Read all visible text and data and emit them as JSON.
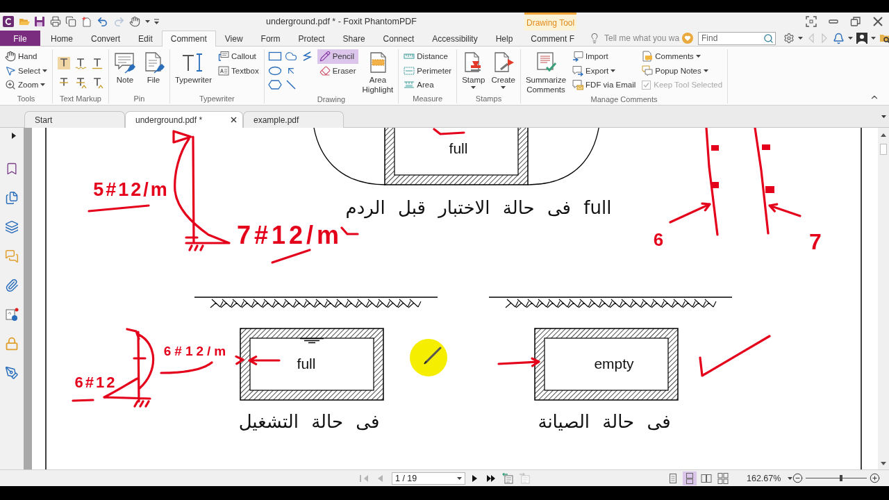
{
  "window": {
    "title": "underground.pdf * - Foxit PhantomPDF",
    "context_tab": "Drawing Tool"
  },
  "ribbon_tabs": [
    {
      "label": "File",
      "kind": "file",
      "selected": false
    },
    {
      "label": "Home",
      "kind": "tab",
      "selected": false
    },
    {
      "label": "Convert",
      "kind": "tab",
      "selected": false
    },
    {
      "label": "Edit",
      "kind": "tab",
      "selected": false
    },
    {
      "label": "Comment",
      "kind": "tab",
      "selected": true
    },
    {
      "label": "View",
      "kind": "tab",
      "selected": false
    },
    {
      "label": "Form",
      "kind": "tab",
      "selected": false
    },
    {
      "label": "Protect",
      "kind": "tab",
      "selected": false
    },
    {
      "label": "Share",
      "kind": "tab",
      "selected": false
    },
    {
      "label": "Connect",
      "kind": "tab",
      "selected": false
    },
    {
      "label": "Accessibility",
      "kind": "tab",
      "selected": false
    },
    {
      "label": "Help",
      "kind": "tab",
      "selected": false
    },
    {
      "label": "Comment F",
      "kind": "tab",
      "selected": false
    }
  ],
  "tell_me": {
    "placeholder": "Tell me what you wa"
  },
  "find": {
    "placeholder": "Find"
  },
  "toolbar_nav": [
    {
      "disabled": true
    },
    {
      "disabled": true
    }
  ],
  "ribbon_groups": [
    {
      "label": "Tools",
      "items": [
        {
          "kind": "small",
          "label": "Hand",
          "selected": false,
          "dropdown": false
        },
        {
          "kind": "small",
          "label": "Select",
          "selected": false,
          "dropdown": true
        },
        {
          "kind": "small",
          "label": "Zoom",
          "selected": false,
          "dropdown": true
        }
      ]
    },
    {
      "label": "Text Markup",
      "items": [
        {
          "kind": "icon",
          "selected": false
        },
        {
          "kind": "icon",
          "selected": false
        },
        {
          "kind": "icon",
          "selected": false
        },
        {
          "kind": "icon",
          "selected": false
        },
        {
          "kind": "icon",
          "selected": false
        },
        {
          "kind": "icon",
          "selected": false
        }
      ]
    },
    {
      "label": "Pin",
      "items": [
        {
          "kind": "large",
          "label": "Note",
          "selected": false,
          "dropdown": false
        },
        {
          "kind": "large",
          "label": "File",
          "selected": false,
          "dropdown": false
        }
      ]
    },
    {
      "label": "Typewriter",
      "items": [
        {
          "kind": "large",
          "label": "Typewriter",
          "selected": false,
          "dropdown": false
        },
        {
          "kind": "small",
          "label": "Callout",
          "selected": false,
          "dropdown": false
        },
        {
          "kind": "small",
          "label": "Textbox",
          "selected": false,
          "dropdown": false
        }
      ]
    },
    {
      "label": "Drawing",
      "items": [
        {
          "kind": "icon",
          "selected": false
        },
        {
          "kind": "icon",
          "selected": false
        },
        {
          "kind": "icon",
          "selected": false
        },
        {
          "kind": "icon",
          "selected": false
        },
        {
          "kind": "icon",
          "selected": false
        },
        {
          "kind": "icon",
          "selected": false
        },
        {
          "kind": "icon",
          "selected": false
        },
        {
          "kind": "small",
          "label": "Pencil",
          "selected": true,
          "dropdown": false
        },
        {
          "kind": "small",
          "label": "Eraser",
          "selected": false,
          "dropdown": false
        },
        {
          "kind": "large",
          "label": "Area Highlight",
          "selected": false,
          "dropdown": false
        }
      ]
    },
    {
      "label": "Measure",
      "items": [
        {
          "kind": "small",
          "label": "Distance",
          "selected": false,
          "dropdown": false
        },
        {
          "kind": "small",
          "label": "Perimeter",
          "selected": false,
          "dropdown": false
        },
        {
          "kind": "small",
          "label": "Area",
          "selected": false,
          "dropdown": false
        }
      ]
    },
    {
      "label": "Stamps",
      "items": [
        {
          "kind": "large",
          "label": "Stamp",
          "selected": false,
          "dropdown": true
        },
        {
          "kind": "large",
          "label": "Create",
          "selected": false,
          "dropdown": true
        }
      ]
    },
    {
      "label": "Manage Comments",
      "items": [
        {
          "kind": "large",
          "label": "Summarize Comments",
          "selected": false,
          "dropdown": false
        },
        {
          "kind": "small",
          "label": "Import",
          "selected": false,
          "dropdown": false
        },
        {
          "kind": "small",
          "label": "Export",
          "selected": false,
          "dropdown": true
        },
        {
          "kind": "small",
          "label": "FDF via Email",
          "selected": false,
          "dropdown": false
        },
        {
          "kind": "small",
          "label": "Comments",
          "selected": false,
          "dropdown": true
        },
        {
          "kind": "small",
          "label": "Popup Notes",
          "selected": false,
          "dropdown": true
        },
        {
          "kind": "check",
          "label": "Keep Tool Selected",
          "checked": true,
          "disabled": true
        }
      ]
    }
  ],
  "doc_tabs": [
    {
      "label": "Start",
      "selected": false
    },
    {
      "label": "underground.pdf *",
      "selected": true
    },
    {
      "label": "example.pdf",
      "selected": false
    }
  ],
  "document": {
    "diagrams": [
      {
        "label": "full",
        "caption": "full فى حالة الاختبار قبل الردم"
      },
      {
        "label": "empty",
        "caption": "فى حالة الصيانة"
      },
      {
        "label": "full",
        "caption": "فى حالة التشغيل"
      }
    ],
    "ink_notes": [
      "5#12/m",
      "7#12/m",
      "6",
      "7",
      "6#12/m",
      "6#12"
    ]
  },
  "status_bar": {
    "nav_back": [
      {
        "disabled": true
      },
      {
        "disabled": true
      }
    ],
    "page": "1 / 19",
    "nav_forward": [
      {
        "disabled": false
      },
      {
        "disabled": false
      }
    ],
    "history": [
      {
        "disabled": false
      },
      {
        "disabled": true
      }
    ],
    "view_modes": [
      {
        "selected": false
      },
      {
        "selected": true
      },
      {
        "selected": false
      },
      {
        "selected": false
      }
    ],
    "zoom": "162.67%",
    "zoom_slider": {
      "level": 0.58
    }
  }
}
